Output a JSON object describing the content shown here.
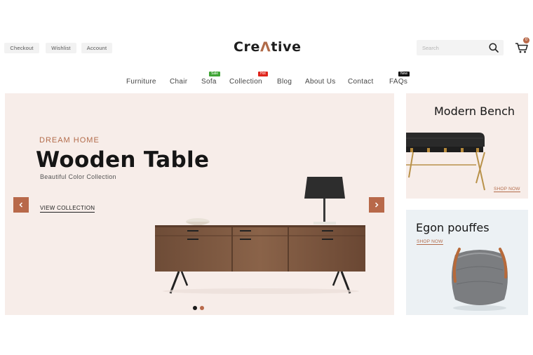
{
  "header": {
    "links": [
      "Checkout",
      "Wishlist",
      "Account"
    ],
    "logo": {
      "before": "Cre",
      "accent": "Λ",
      "after": "tive"
    },
    "search": {
      "placeholder": "Search",
      "icon": "search-icon"
    },
    "cart": {
      "count": "0",
      "icon": "cart-icon"
    }
  },
  "nav": {
    "items": [
      {
        "label": "Furniture",
        "badge": ""
      },
      {
        "label": "Chair",
        "badge": ""
      },
      {
        "label": "Sofa",
        "badge": "Sale"
      },
      {
        "label": "Collection",
        "badge": "Hot"
      },
      {
        "label": "Blog",
        "badge": ""
      },
      {
        "label": "About Us",
        "badge": ""
      },
      {
        "label": "Contact",
        "badge": ""
      },
      {
        "label": "FAQs",
        "badge": "New"
      }
    ]
  },
  "hero": {
    "subtitle": "DREAM HOME",
    "title": "Wooden Table",
    "description": "Beautiful Color Collection",
    "cta": "VIEW COLLECTION",
    "prev_icon": "chevron-left-icon",
    "next_icon": "chevron-right-icon",
    "slides": 2,
    "active_slide": 1
  },
  "banners": [
    {
      "title": "Modern Bench",
      "link": "SHOP NOW"
    },
    {
      "title": "Egon pouffes",
      "link": "SHOP NOW"
    }
  ],
  "colors": {
    "accent": "#b8694a",
    "hero_bg": "#f7ede9",
    "banner2_bg": "#ecf1f4",
    "badge_sale": "#3fa535",
    "badge_hot": "#e0241b",
    "badge_new": "#111111"
  }
}
